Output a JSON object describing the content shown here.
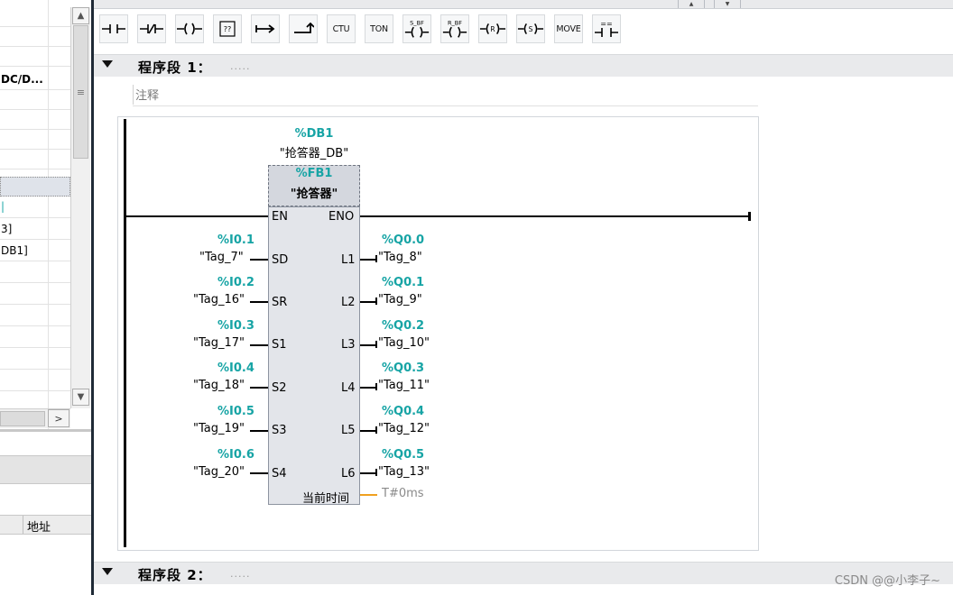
{
  "left_panel": {
    "items": [
      {
        "text": "DC/D...",
        "style": "bold"
      },
      {
        "text": "",
        "style": "selected"
      },
      {
        "text": "3]",
        "style": "normal"
      },
      {
        "text": "DB1]",
        "style": "normal"
      }
    ],
    "table_header": "地址"
  },
  "toolbar": {
    "buttons": [
      {
        "icon": "normally-open-contact-icon"
      },
      {
        "icon": "normally-closed-contact-icon"
      },
      {
        "icon": "coil-icon"
      },
      {
        "icon": "empty-box-icon",
        "label": "??"
      },
      {
        "icon": "open-branch-icon"
      },
      {
        "icon": "close-branch-icon"
      },
      {
        "label": "CTU"
      },
      {
        "label": "TON"
      },
      {
        "icon": "set-bit-field-icon",
        "label": "S_BF"
      },
      {
        "icon": "reset-bit-field-icon",
        "label": "R_BF"
      },
      {
        "icon": "reset-coil-icon",
        "label": "R"
      },
      {
        "icon": "set-coil-icon",
        "label": "S"
      },
      {
        "label": "MOVE"
      },
      {
        "icon": "compare-equal-icon",
        "label": "=="
      }
    ]
  },
  "network1": {
    "title": "程序段 1：",
    "dots": ".....",
    "comment": "注释"
  },
  "network2": {
    "title": "程序段 2：",
    "dots": "....."
  },
  "block": {
    "instance_db_addr": "%DB1",
    "instance_db_name": "\"抢答器_DB\"",
    "fb_addr": "%FB1",
    "fb_name": "\"抢答器\"",
    "en": "EN",
    "eno": "ENO",
    "inputs": [
      {
        "pin": "SD",
        "addr": "%I0.1",
        "tag": "\"Tag_7\""
      },
      {
        "pin": "SR",
        "addr": "%I0.2",
        "tag": "\"Tag_16\""
      },
      {
        "pin": "S1",
        "addr": "%I0.3",
        "tag": "\"Tag_17\""
      },
      {
        "pin": "S2",
        "addr": "%I0.4",
        "tag": "\"Tag_18\""
      },
      {
        "pin": "S3",
        "addr": "%I0.5",
        "tag": "\"Tag_19\""
      },
      {
        "pin": "S4",
        "addr": "%I0.6",
        "tag": "\"Tag_20\""
      }
    ],
    "outputs": [
      {
        "pin": "L1",
        "addr": "%Q0.0",
        "tag": "\"Tag_8\""
      },
      {
        "pin": "L2",
        "addr": "%Q0.1",
        "tag": "\"Tag_9\""
      },
      {
        "pin": "L3",
        "addr": "%Q0.2",
        "tag": "\"Tag_10\""
      },
      {
        "pin": "L4",
        "addr": "%Q0.3",
        "tag": "\"Tag_11\""
      },
      {
        "pin": "L5",
        "addr": "%Q0.4",
        "tag": "\"Tag_12\""
      },
      {
        "pin": "L6",
        "addr": "%Q0.5",
        "tag": "\"Tag_13\""
      }
    ],
    "extra_pin": "当前时间",
    "extra_value": "T#0ms"
  },
  "watermark": "CSDN @@小李子~",
  "colors": {
    "accent_teal": "#17a4a5",
    "orange_wire": "#f0a020",
    "header_bg": "#e9eaec",
    "power_rail": "#000000"
  }
}
